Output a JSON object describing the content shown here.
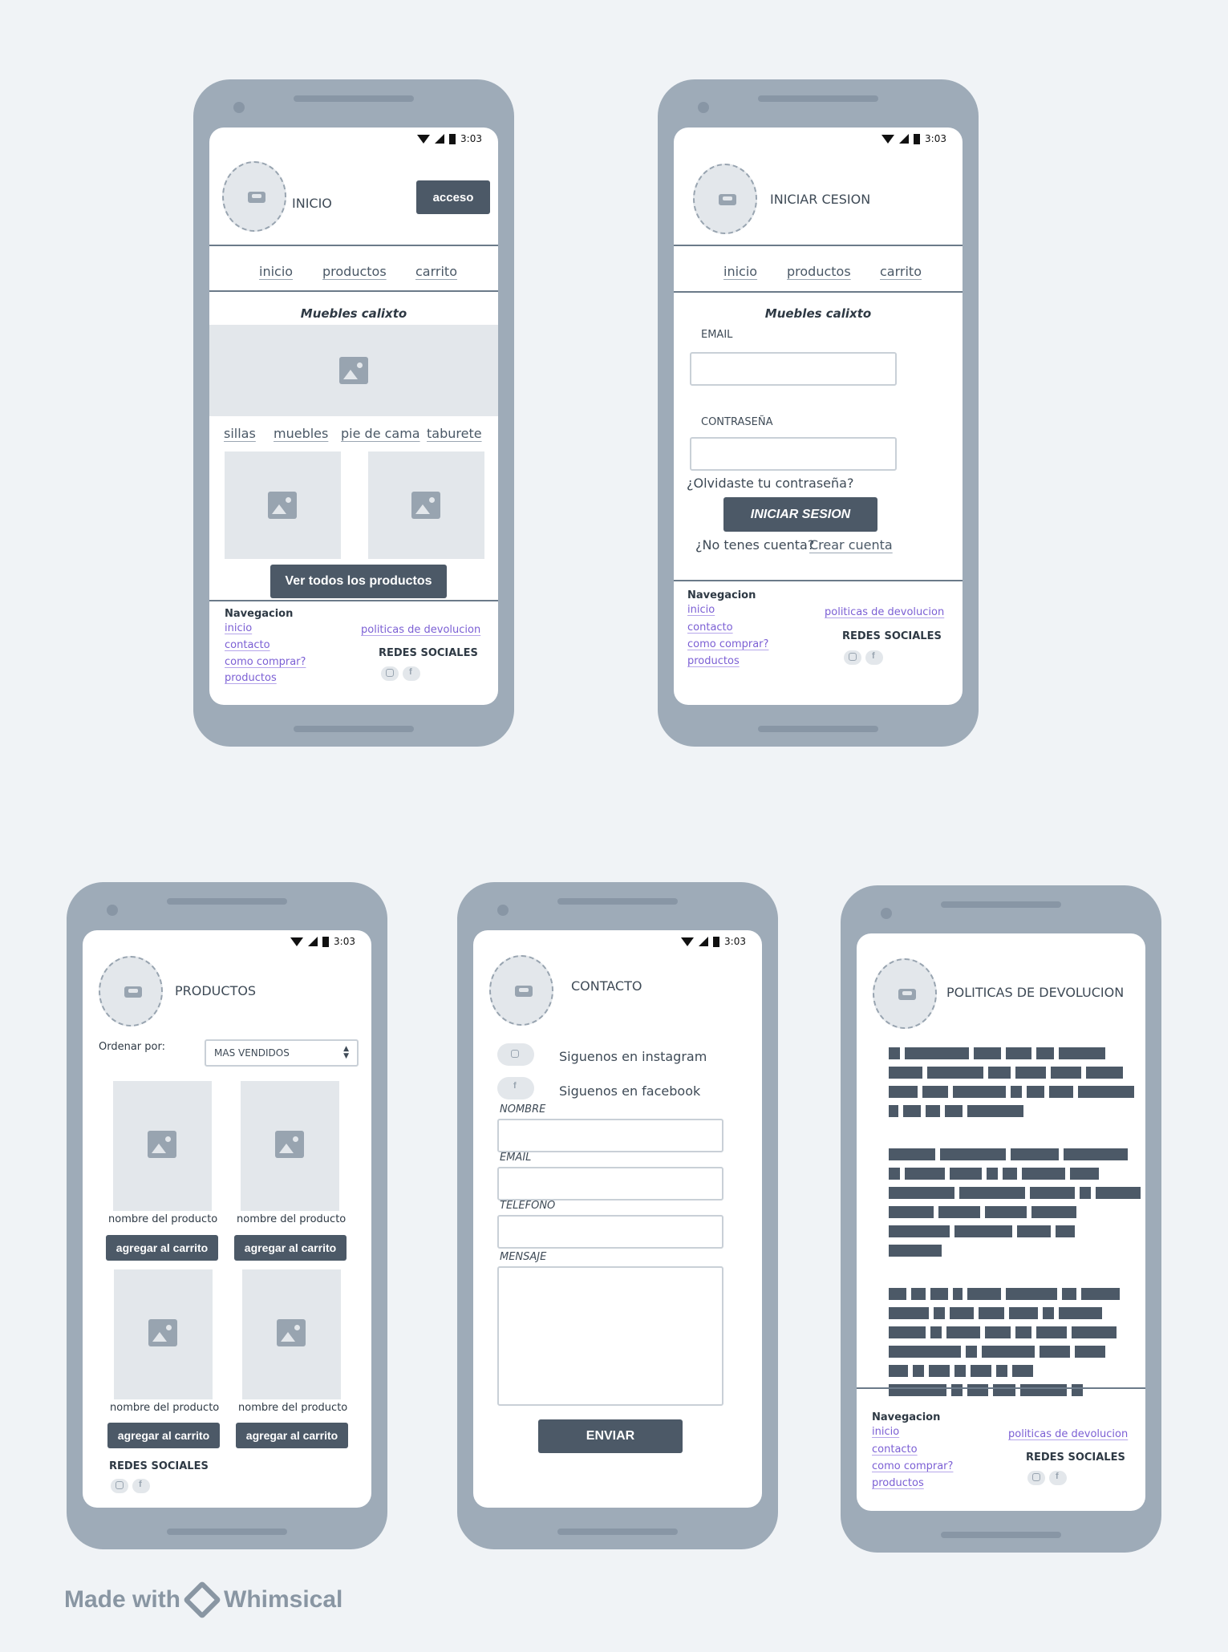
{
  "status": {
    "time": "3:03"
  },
  "nav": {
    "inicio": "inicio",
    "productos": "productos",
    "carrito": "carrito"
  },
  "brand": "Muebles calixto",
  "footer": {
    "heading": "Navegacion",
    "inicio": "inicio",
    "contacto": "contacto",
    "como_comprar": "como comprar?",
    "productos": "productos",
    "politicas": "politicas de devolucion",
    "redes": "REDES SOCIALES"
  },
  "home": {
    "title": "INICIO",
    "acceso": "acceso",
    "cats": [
      "sillas",
      "muebles",
      "pie de cama",
      "taburete"
    ],
    "ver_todos": "Ver todos los productos"
  },
  "login": {
    "title": "INICIAR CESION",
    "email_label": "EMAIL",
    "pass_label": "CONTRASEÑA",
    "forgot": "¿Olvidaste tu contraseña?",
    "submit": "INICIAR SESION",
    "no_account": "¿No tenes cuenta?",
    "create": "Crear cuenta"
  },
  "products": {
    "title": "PRODUCTOS",
    "sort_label": "Ordenar por:",
    "sort_value": "MAS VENDIDOS",
    "item_name": "nombre del producto",
    "add_cart": "agregar al carrito",
    "redes": "REDES SOCIALES"
  },
  "contact": {
    "title": "CONTACTO",
    "instagram": "Siguenos en instagram",
    "facebook": "Siguenos en facebook",
    "nombre": "NOMBRE",
    "email": "EMAIL",
    "telefono": "TELEFONO",
    "mensaje": "MENSAJE",
    "enviar": "ENVIAR"
  },
  "policies": {
    "title": "POLITICAS DE DEVOLUCION"
  },
  "watermark": {
    "made_with": "Made with",
    "brand": "Whimsical"
  }
}
